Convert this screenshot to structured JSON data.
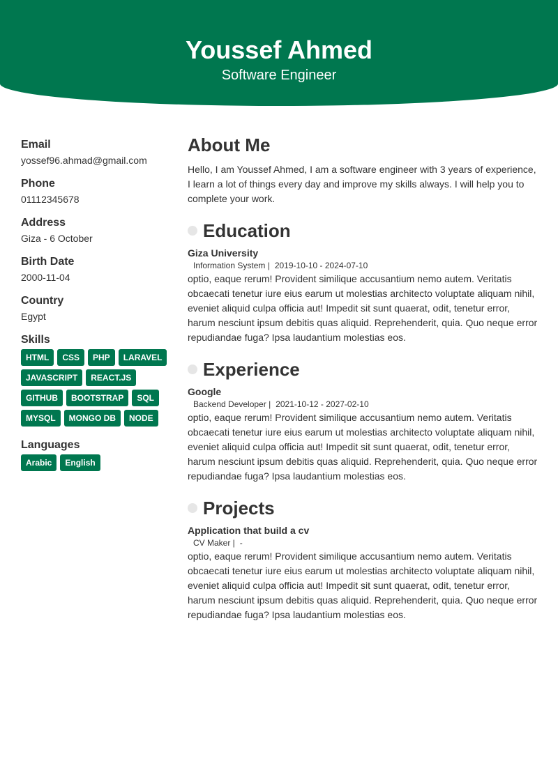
{
  "header": {
    "name": "Youssef Ahmed",
    "title": "Software Engineer",
    "background_color": "#00774f"
  },
  "sidebar": {
    "info": [
      {
        "label": "Email",
        "value": "yossef96.ahmad@gmail.com"
      },
      {
        "label": "Phone",
        "value": "01112345678"
      },
      {
        "label": "Address",
        "value": "Giza - 6 October"
      },
      {
        "label": "Birth Date",
        "value": "2000-11-04"
      },
      {
        "label": "Country",
        "value": "Egypt"
      }
    ],
    "skills_label": "Skills",
    "skills": [
      "HTML",
      "CSS",
      "PHP",
      "LARAVEL",
      "JAVASCRIPT",
      "REACT.JS",
      "GITHUB",
      "BOOTSTRAP",
      "SQL",
      "MYSQL",
      "MONGO DB",
      "NODE"
    ],
    "languages_label": "Languages",
    "languages": [
      "Arabic",
      "English"
    ],
    "tag_color": "#00774f"
  },
  "main": {
    "about": {
      "heading": "About Me",
      "text": "Hello, I am Youssef Ahmed, I am a software engineer with 3 years of experience, I learn a lot of things every day and improve my skills always. I will help you to complete your work."
    },
    "education": {
      "heading": "Education",
      "entries": [
        {
          "title": "Giza University",
          "role": "Information System |",
          "dates": "2019-10-10 - 2024-07-10",
          "description": "optio, eaque rerum! Provident similique accusantium nemo autem. Veritatis obcaecati tenetur iure eius earum ut molestias architecto voluptate aliquam nihil, eveniet aliquid culpa officia aut! Impedit sit sunt quaerat, odit, tenetur error, harum nesciunt ipsum debitis quas aliquid. Reprehenderit, quia. Quo neque error repudiandae fuga? Ipsa laudantium molestias eos."
        }
      ]
    },
    "experience": {
      "heading": "Experience",
      "entries": [
        {
          "title": "Google",
          "role": "Backend Developer |",
          "dates": "2021-10-12 - 2027-02-10",
          "description": "optio, eaque rerum! Provident similique accusantium nemo autem. Veritatis obcaecati tenetur iure eius earum ut molestias architecto voluptate aliquam nihil, eveniet aliquid culpa officia aut! Impedit sit sunt quaerat, odit, tenetur error, harum nesciunt ipsum debitis quas aliquid. Reprehenderit, quia. Quo neque error repudiandae fuga? Ipsa laudantium molestias eos."
        }
      ]
    },
    "projects": {
      "heading": "Projects",
      "entries": [
        {
          "title": "Application that build a cv",
          "role": "CV Maker |",
          "dates": "-",
          "description": "optio, eaque rerum! Provident similique accusantium nemo autem. Veritatis obcaecati tenetur iure eius earum ut molestias architecto voluptate aliquam nihil, eveniet aliquid culpa officia aut! Impedit sit sunt quaerat, odit, tenetur error, harum nesciunt ipsum debitis quas aliquid. Reprehenderit, quia. Quo neque error repudiandae fuga? Ipsa laudantium molestias eos."
        }
      ]
    }
  }
}
